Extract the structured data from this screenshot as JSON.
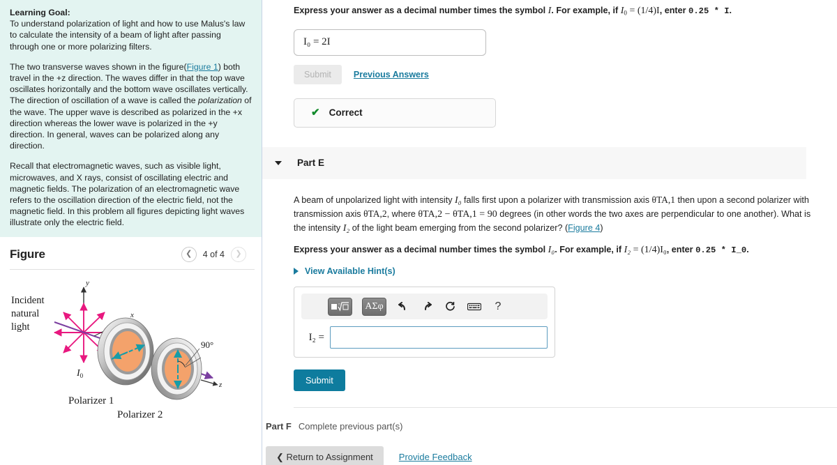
{
  "left": {
    "learning_goal_title": "Learning Goal:",
    "learning_goal_text": "To understand polarization of light and how to use Malus's law to calculate the intensity of a beam of light after passing through one or more polarizing filters.",
    "para2_a": "The two transverse waves shown in the figure(",
    "figure1_link": "Figure 1",
    "para2_b": ") both travel in the +z direction. The waves differ in that the top wave oscillates horizontally and the bottom wave oscillates vertically. The direction of oscillation of a wave is called the ",
    "para2_italic": "polarization",
    "para2_c": " of the wave. The upper wave is described as polarized in the +x direction whereas the lower wave is polarized in the +y direction. In general, waves can be polarized along any direction.",
    "para3": "Recall that electromagnetic waves, such as visible light, microwaves, and X rays, consist of oscillating electric and magnetic fields. The polarization of an electromagnetic wave refers to the oscillation direction of the electric field, not the magnetic field. In this problem all figures depicting light waves illustrate only the electric field.",
    "figure_title": "Figure",
    "figure_count": "4 of 4",
    "prev_icon": "chevron-left-icon",
    "next_icon": "chevron-right-icon",
    "diagram": {
      "label_incident_1": "Incident",
      "label_incident_2": "natural",
      "label_incident_3": "light",
      "axis_y": "y",
      "axis_x": "x",
      "axis_z": "z",
      "intensity_label": "I",
      "intensity_sub": "0",
      "angle_label": "90°",
      "polarizer1": "Polarizer 1",
      "polarizer2": "Polarizer 2"
    }
  },
  "right": {
    "prev_part": {
      "instruction_a": "Express your answer as a decimal number times the symbol ",
      "instruction_sym": "I",
      "instruction_b": ". For example, if ",
      "instruction_eq_lhs": "I",
      "instruction_eq_lhs_sub": "0",
      "instruction_eq_rhs": " = (1/4)I",
      "instruction_c": ", enter ",
      "instruction_mono": "0.25 * I",
      "instruction_d": ".",
      "answer_value": "I₀ = 2I",
      "submit_label": "Submit",
      "previous_answers_label": "Previous Answers",
      "feedback_label": "Correct",
      "check_icon": "check-icon"
    },
    "part_e": {
      "caret_icon": "caret-down-icon",
      "title": "Part E",
      "question_a": "A beam of unpolarized light with intensity ",
      "question_I0": "I₀",
      "question_b": " falls first upon a polarizer with transmission axis ",
      "question_theta1": "θTA,1",
      "question_c": " then upon a second polarizer with transmission axis ",
      "question_theta2": "θTA,2",
      "question_d": ", where ",
      "question_eq": "θTA,2 − θTA,1 = 90",
      "question_e": " degrees (in other words the two axes are perpendicular to one another). What is the intensity ",
      "question_I2": "I₂",
      "question_f": " of the light beam emerging from the second polarizer? (",
      "figure4_link": "Figure 4",
      "question_g": ")",
      "instruction_a": "Express your answer as a decimal number times the symbol ",
      "instruction_I0": "I₀",
      "instruction_b": ". For example, if ",
      "instruction_I2": "I₂",
      "instruction_c": " = (1/4)I₀",
      "instruction_d": ", enter ",
      "instruction_mono": "0.25 * I_0",
      "instruction_e": ".",
      "hint_label": "View Available Hint(s)",
      "hint_icon": "caret-right-icon",
      "toolbar": {
        "template_btn": "■√□",
        "greek_btn": "ΑΣφ",
        "undo_icon": "undo-arrow-icon",
        "redo_icon": "redo-arrow-icon",
        "reset_icon": "reset-circle-icon",
        "keyboard_icon": "keyboard-icon",
        "help_icon": "help-question-icon",
        "undo_glyph": "←",
        "redo_glyph": "→",
        "reset_glyph": "↺",
        "keyboard_glyph": "⌨",
        "help_glyph": "?"
      },
      "answer_label": "I₂ =",
      "answer_value": "",
      "answer_placeholder": "",
      "submit_label": "Submit"
    },
    "part_f": {
      "label": "Part F",
      "text": "Complete previous part(s)"
    },
    "footer": {
      "return_label": "❮ Return to Assignment",
      "feedback_label": "Provide Feedback"
    }
  },
  "colors": {
    "accent": "#1a7b9e",
    "submit_blue": "#0e7c9e",
    "correct_green": "#128a2b",
    "intro_bg": "#e3f4f1",
    "band_bg": "#f7f7f7",
    "polarizer_orange": "#f4a26b",
    "ray_magenta": "#e8187f",
    "beam_purple": "#7b3fa0",
    "axis_teal": "#179ca8"
  }
}
